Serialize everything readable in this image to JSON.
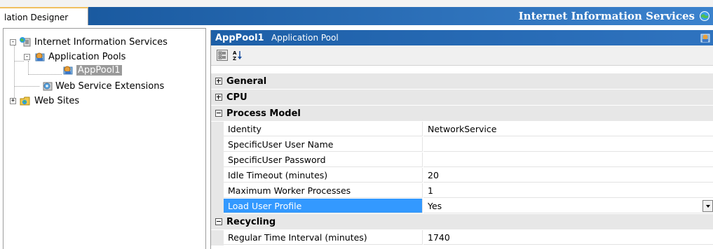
{
  "window": {
    "tab_label": "lation Designer",
    "title": "Internet Information Services",
    "title_icon": "iis-globe-icon"
  },
  "tree": {
    "root": {
      "label": "Internet Information Services",
      "icon": "iis-globe-icon",
      "expander": "-"
    },
    "app_pools": {
      "label": "Application Pools",
      "icon": "app-pool-folder-icon",
      "expander": "-"
    },
    "app_pool1": {
      "label": "AppPool1",
      "icon": "app-pool-icon",
      "selected": true
    },
    "web_ext": {
      "label": "Web Service Extensions",
      "icon": "gear-icon"
    },
    "web_sites": {
      "label": "Web Sites",
      "icon": "folder-icon",
      "expander": "+"
    }
  },
  "properties": {
    "header": {
      "name": "AppPool1",
      "kind": "Application Pool",
      "icon": "app-pool-icon"
    },
    "toolbar": {
      "categorized_icon": "categorized-icon",
      "alphabetical_icon": "sort-az-icon"
    },
    "categories": {
      "general": {
        "label": "General",
        "expanded": false
      },
      "cpu": {
        "label": "CPU",
        "expanded": false
      },
      "process_model": {
        "label": "Process Model",
        "expanded": true
      },
      "recycling": {
        "label": "Recycling",
        "expanded": true
      }
    },
    "rows": [
      {
        "name": "Identity",
        "value": "NetworkService"
      },
      {
        "name": "SpecificUser User Name",
        "value": ""
      },
      {
        "name": "SpecificUser Password",
        "value": ""
      },
      {
        "name": "Idle Timeout (minutes)",
        "value": "20"
      },
      {
        "name": "Maximum Worker Processes",
        "value": "1"
      },
      {
        "name": "Load User Profile",
        "value": "Yes",
        "selected": true
      },
      {
        "name": "Regular Time Interval (minutes)",
        "value": "1740"
      }
    ],
    "selection_color": "#3399ff"
  }
}
